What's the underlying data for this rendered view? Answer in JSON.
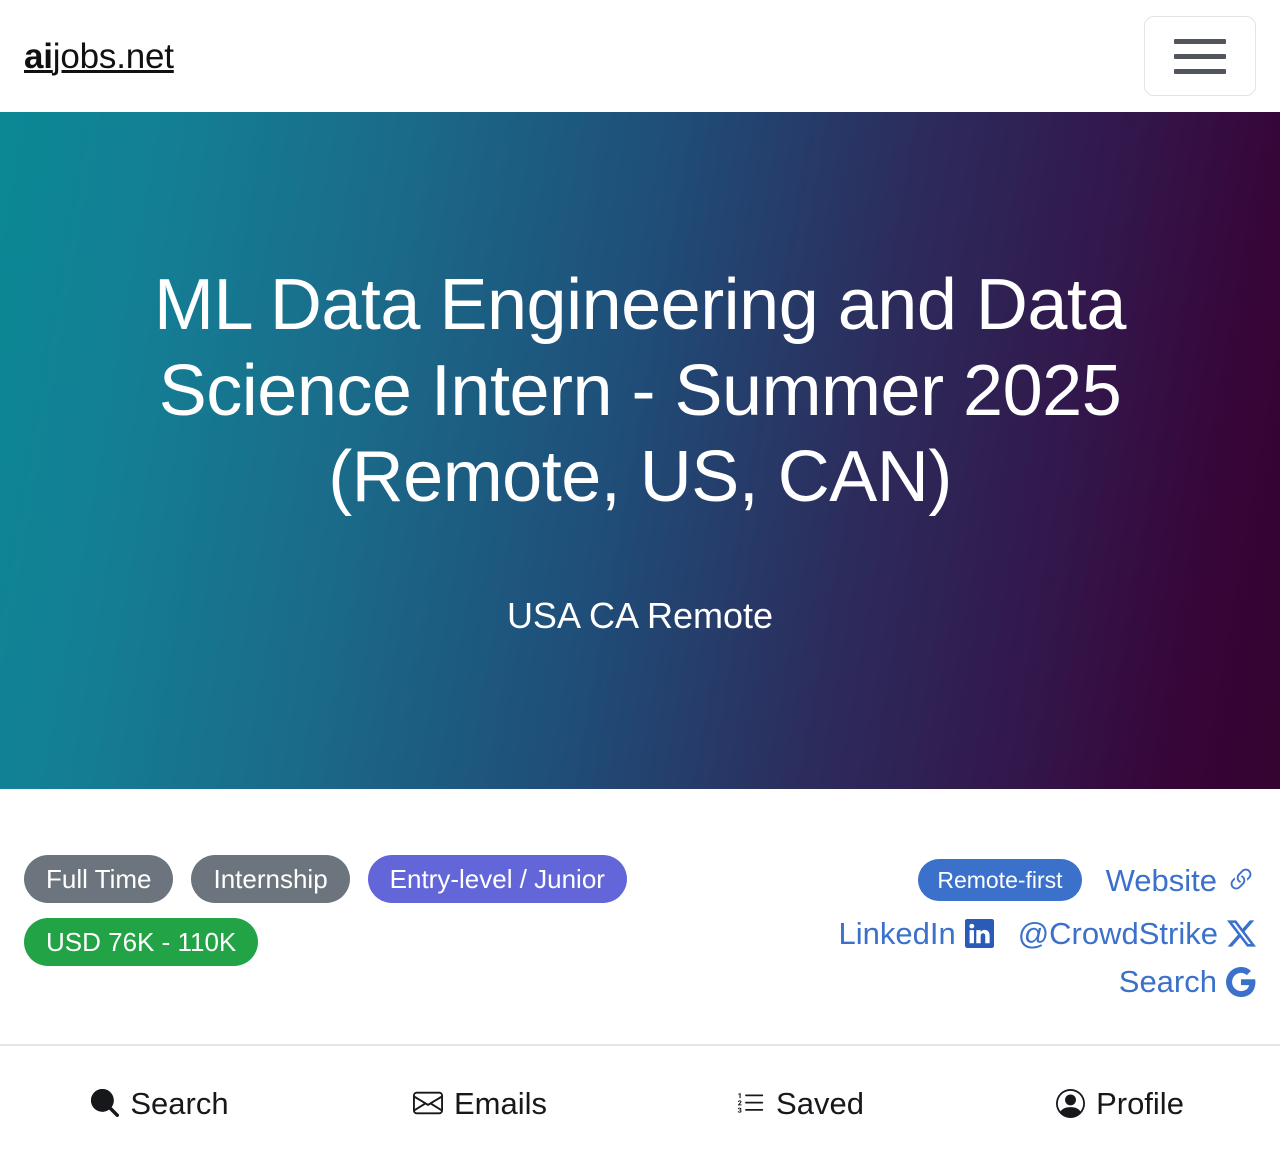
{
  "header": {
    "brand_bold": "ai",
    "brand_rest": "jobs.net",
    "menu_label": "Toggle navigation"
  },
  "hero": {
    "title": "ML Data Engineering and Data Science Intern - Summer 2025 (Remote, US, CAN)",
    "subtitle": "USA CA Remote",
    "gradient_from": "#0b8894",
    "gradient_mid": "#1f4e79",
    "gradient_to": "#36042f"
  },
  "meta": {
    "tags": [
      {
        "label": "Full Time",
        "color": "#6c757d",
        "style": "tag--secondary"
      },
      {
        "label": "Internship",
        "color": "#6c757d",
        "style": "tag--secondary"
      },
      {
        "label": "Entry-level / Junior",
        "color": "#6366d8",
        "style": "tag--indigo"
      },
      {
        "label": "USD 76K - 110K",
        "color": "#22a346",
        "style": "tag--success"
      }
    ],
    "remote_badge": "Remote-first",
    "remote_badge_color": "#3b71ca",
    "link_color": "#3b71ca",
    "links": [
      {
        "label": "Website",
        "icon": "link-chain-icon"
      },
      {
        "label": "LinkedIn",
        "icon": "linkedin-icon"
      },
      {
        "label": "@CrowdStrike",
        "icon": "x-twitter-icon"
      },
      {
        "label": "Search",
        "icon": "google-g-icon"
      }
    ]
  },
  "bottom_nav": {
    "items": [
      {
        "label": "Search",
        "icon": "search-icon"
      },
      {
        "label": "Emails",
        "icon": "envelope-icon"
      },
      {
        "label": "Saved",
        "icon": "numbered-list-icon"
      },
      {
        "label": "Profile",
        "icon": "person-circle-icon"
      }
    ]
  }
}
